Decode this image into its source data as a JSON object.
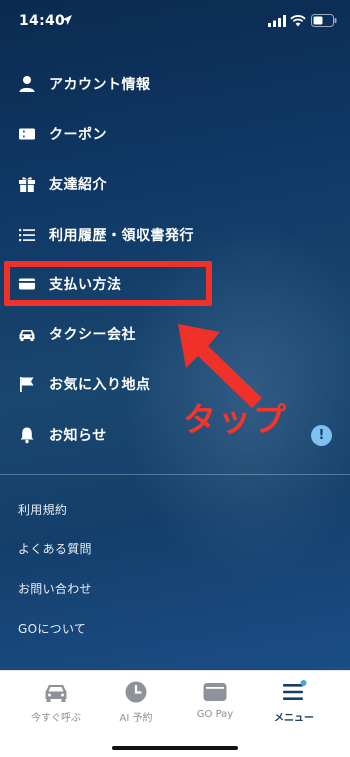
{
  "status_bar": {
    "time": "14:40"
  },
  "menu": {
    "items": [
      {
        "label": "アカウント情報",
        "icon": "person-icon"
      },
      {
        "label": "クーポン",
        "icon": "ticket-icon"
      },
      {
        "label": "友達紹介",
        "icon": "gift-icon"
      },
      {
        "label": "利用履歴・領収書発行",
        "icon": "list-icon"
      },
      {
        "label": "支払い方法",
        "icon": "card-icon"
      },
      {
        "label": "タクシー会社",
        "icon": "taxi-icon"
      },
      {
        "label": "お気に入り地点",
        "icon": "flag-icon"
      },
      {
        "label": "お知らせ",
        "icon": "bell-icon"
      }
    ],
    "notification_badge": "!"
  },
  "links": [
    "利用規約",
    "よくある質問",
    "お問い合わせ",
    "GOについて"
  ],
  "annotation": {
    "tap_text": "タップ",
    "color": "#f0312a"
  },
  "tab_bar": {
    "tabs": [
      {
        "label": "今すぐ呼ぶ",
        "icon": "car-icon"
      },
      {
        "label": "AI 予約",
        "icon": "clock-icon"
      },
      {
        "label": "GO Pay",
        "icon": "wallet-icon"
      },
      {
        "label": "メニュー",
        "icon": "menu-icon",
        "active": true
      }
    ]
  },
  "colors": {
    "background": "#0f3866",
    "accent": "#1d3e63",
    "badge": "#7ec0ef"
  }
}
